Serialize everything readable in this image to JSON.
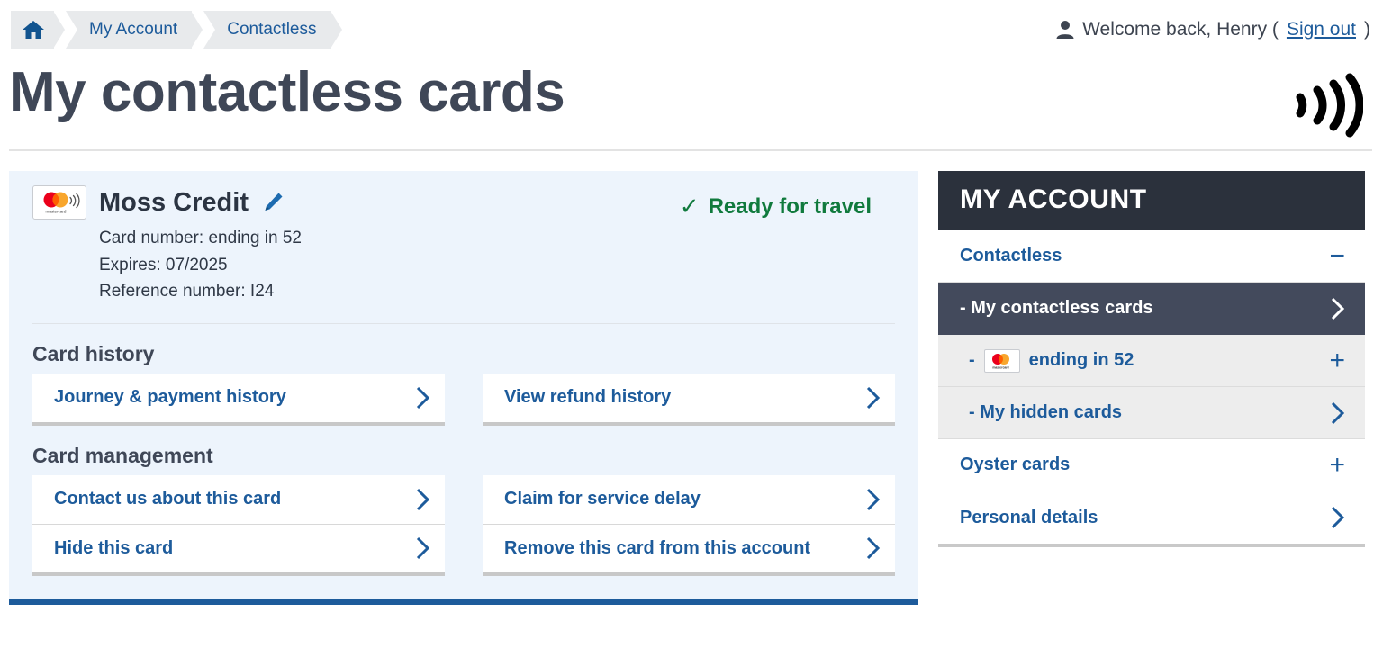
{
  "breadcrumb": {
    "home_icon": "home-icon",
    "items": [
      {
        "label": "My Account"
      },
      {
        "label": "Contactless"
      }
    ]
  },
  "welcome": {
    "icon": "person-icon",
    "text": "Welcome back, Henry (",
    "signout": "Sign out",
    "close": ")"
  },
  "header": {
    "title": "My contactless cards",
    "mark_icon": "contactless-waves-icon"
  },
  "card": {
    "brand_icon": "mastercard-contactless-icon",
    "name": "Moss Credit",
    "edit_icon": "pencil-icon",
    "card_number": "Card number: ending in 52",
    "expires": "Expires: 07/2025",
    "reference": "Reference number: I24",
    "status_tick": "✓",
    "status_text": "Ready for travel",
    "status_color": "#107a3d",
    "sections": [
      {
        "title": "Card history",
        "left": [
          {
            "label": "Journey & payment history",
            "icon": "chevron-right-icon"
          }
        ],
        "right": [
          {
            "label": "View refund history",
            "icon": "chevron-right-icon"
          }
        ]
      },
      {
        "title": "Card management",
        "left": [
          {
            "label": "Contact us about this card",
            "icon": "chevron-right-icon"
          },
          {
            "label": "Hide this card",
            "icon": "chevron-right-icon"
          }
        ],
        "right": [
          {
            "label": "Claim for service delay",
            "icon": "chevron-right-icon"
          },
          {
            "label": "Remove this card from this account",
            "icon": "chevron-right-icon"
          }
        ]
      }
    ]
  },
  "sidebar": {
    "heading": "MY ACCOUNT",
    "items": [
      {
        "label": "Contactless",
        "icon": "minus-icon",
        "style": "top"
      },
      {
        "label": "- My contactless cards",
        "icon": "chevron-right-icon",
        "style": "active"
      },
      {
        "label": "ending in 52",
        "prefix": "-",
        "icon": "plus-icon",
        "style": "sub-card"
      },
      {
        "label": "- My hidden cards",
        "icon": "chevron-right-icon",
        "style": "sub"
      },
      {
        "label": "Oyster cards",
        "icon": "plus-icon",
        "style": "top"
      },
      {
        "label": "Personal details",
        "icon": "chevron-right-icon",
        "style": "top"
      }
    ]
  },
  "colors": {
    "link_blue": "#1d5b9b",
    "panel_blue": "#edf4fc",
    "dark_slate": "#2b313c",
    "active_row": "#434a5c",
    "success_green": "#107a3d"
  }
}
